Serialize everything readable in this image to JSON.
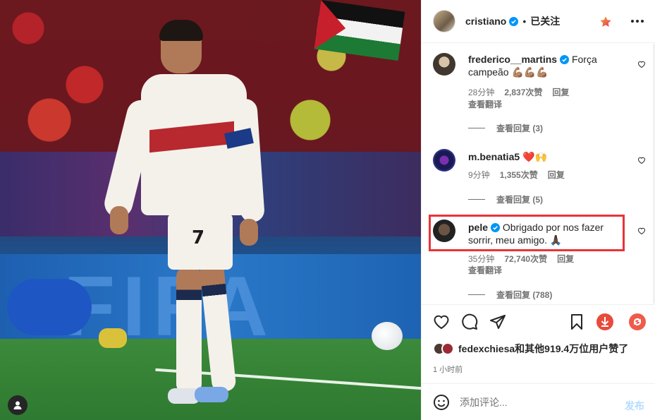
{
  "post": {
    "tag_icon": "user-tag-icon"
  },
  "header": {
    "username": "cristiano",
    "verified": true,
    "dot": "•",
    "follow_status": "已关注",
    "star_icon": "star-icon",
    "more_icon": "more-icon"
  },
  "comments": [
    {
      "username": "frederico__martins",
      "verified": true,
      "text": "Força campeão 💪🏽💪🏽💪🏽",
      "time": "28分钟",
      "likes": "2,837次赞",
      "reply_label": "回复",
      "translate_label": "查看翻译",
      "view_replies": "查看回复 (3)"
    },
    {
      "username": "m.benatia5",
      "verified": false,
      "text": "❤️🙌",
      "time": "9分钟",
      "likes": "1,355次赞",
      "reply_label": "回复",
      "view_replies": "查看回复 (5)"
    },
    {
      "username": "pele",
      "verified": true,
      "text": "Obrigado por nos fazer sorrir, meu amigo. 🙏🏿",
      "time": "35分钟",
      "likes": "72,740次赞",
      "reply_label": "回复",
      "translate_label": "查看翻译",
      "view_replies": "查看回复 (788)",
      "highlighted": true
    }
  ],
  "actions": {
    "like_icon": "heart-icon",
    "comment_icon": "comment-icon",
    "share_icon": "share-icon",
    "save_icon": "bookmark-icon",
    "download_icon": "download-icon",
    "repost_icon": "repost-icon"
  },
  "likes_summary": {
    "text": "fedexchiesa和其他919.4万位用户赞了"
  },
  "timestamp": "1 小时前",
  "add_comment": {
    "placeholder": "添加评论...",
    "post_label": "发布",
    "emoji_icon": "emoji-icon"
  },
  "colors": {
    "verified": "#0095f6",
    "highlight_border": "#e8333a",
    "download_accent": "#e84a3c",
    "post_button_disabled": "#b3dbff"
  }
}
